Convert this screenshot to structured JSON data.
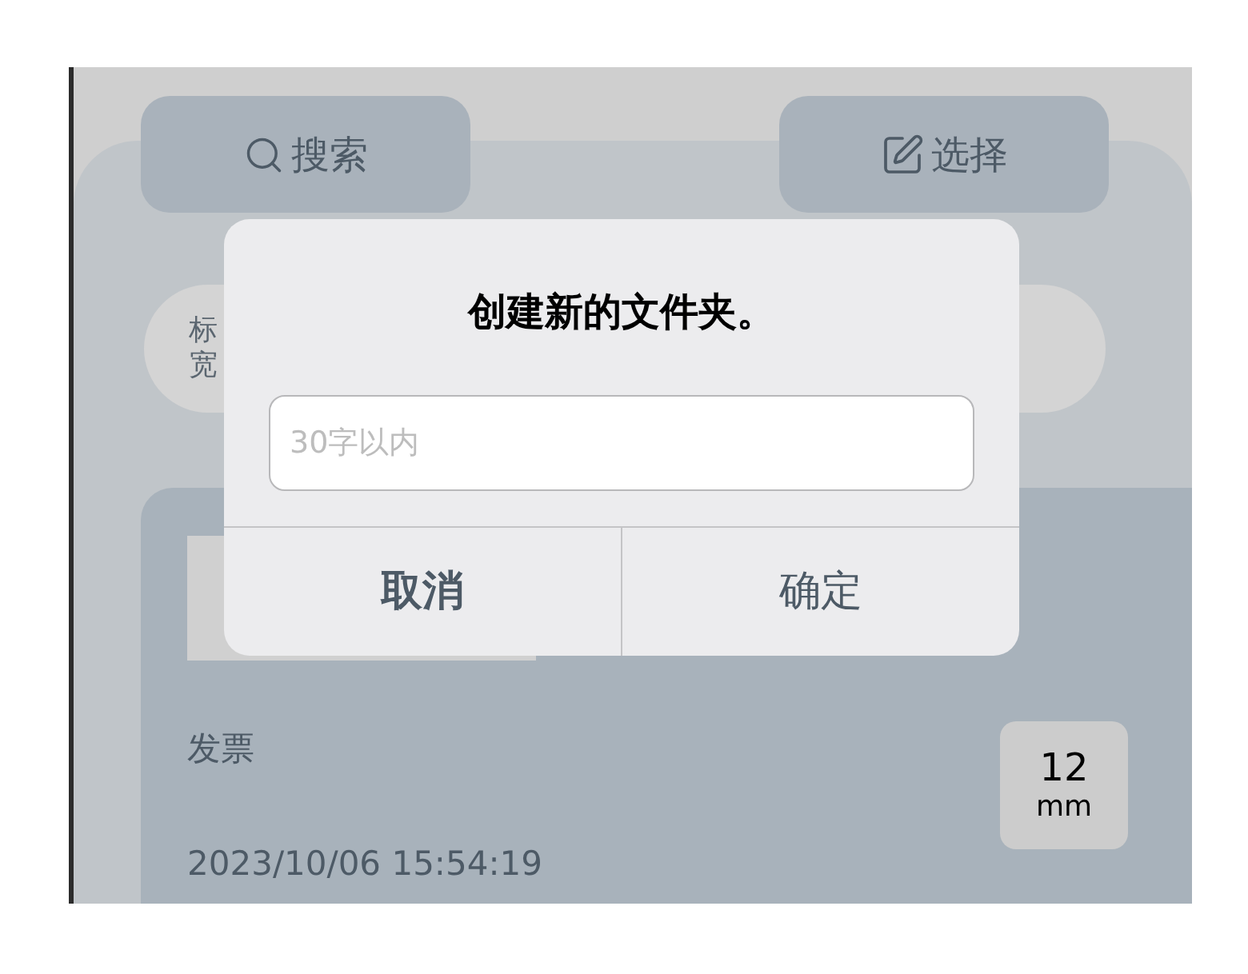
{
  "toolbar": {
    "buttons": [
      {
        "label": "搜索",
        "kind": "search"
      },
      {
        "label": "选择",
        "kind": "select"
      }
    ]
  },
  "filter_chips": [
    {
      "lines": [
        "标",
        "宽"
      ]
    }
  ],
  "file_card": {
    "name": "发票",
    "date": "2023/10/06 15:54:19",
    "size": {
      "value": "12",
      "unit": "mm"
    }
  },
  "dialog": {
    "title": "创建新的文件夹。",
    "input": {
      "placeholder": "30字以内"
    },
    "buttons": [
      {
        "label": "取消",
        "kind": "cancel"
      },
      {
        "label": "确定",
        "kind": "confirm"
      }
    ]
  }
}
